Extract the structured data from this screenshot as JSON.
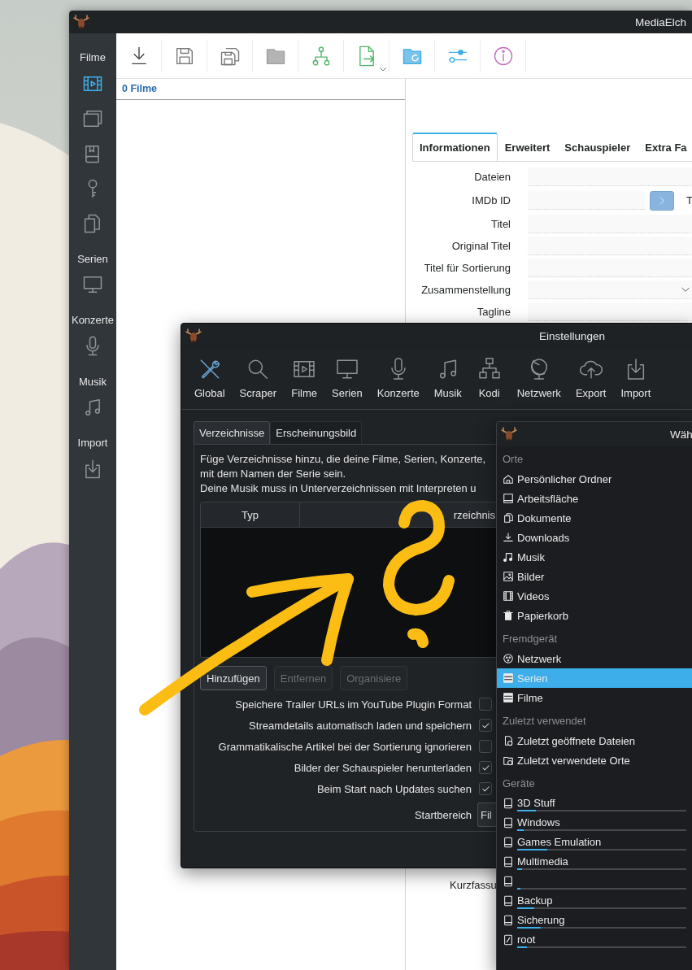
{
  "main_window": {
    "title": "MediaElch",
    "sidebar": [
      {
        "label": "Filme",
        "buttons": [
          {
            "selected": true
          },
          {
            "selected": false
          },
          {
            "selected": false
          },
          {
            "selected": false
          },
          {
            "selected": false
          }
        ]
      },
      {
        "label": "Serien",
        "buttons": [
          {
            "selected": false
          }
        ]
      },
      {
        "label": "Konzerte",
        "buttons": [
          {
            "selected": false
          }
        ]
      },
      {
        "label": "Musik",
        "buttons": [
          {
            "selected": false
          }
        ]
      },
      {
        "label": "Import",
        "buttons": [
          {
            "selected": false
          }
        ]
      }
    ],
    "list_header": "0 Filme",
    "tabs": [
      {
        "label": "Informationen",
        "selected": true
      },
      {
        "label": "Erweitert",
        "selected": false
      },
      {
        "label": "Schauspieler",
        "selected": false
      },
      {
        "label": "Extra Fa",
        "selected": false
      }
    ],
    "fields": [
      {
        "label": "Dateien",
        "kind": "text"
      },
      {
        "label": "IMDb ID",
        "kind": "id",
        "after": "T"
      },
      {
        "label": "Titel",
        "kind": "text"
      },
      {
        "label": "Original Titel",
        "kind": "text"
      },
      {
        "label": "Titel für Sortierung",
        "kind": "text"
      },
      {
        "label": "Zusammenstellung",
        "kind": "dropdown"
      },
      {
        "label": "Tagline",
        "kind": "text"
      }
    ],
    "lower_label": "Kurzfassu"
  },
  "settings": {
    "title": "Einstellungen",
    "categories": [
      {
        "label": "Global",
        "selected": true
      },
      {
        "label": "Scraper",
        "selected": false
      },
      {
        "label": "Filme",
        "selected": false
      },
      {
        "label": "Serien",
        "selected": false
      },
      {
        "label": "Konzerte",
        "selected": false
      },
      {
        "label": "Musik",
        "selected": false
      },
      {
        "label": "Kodi",
        "selected": false
      },
      {
        "label": "Netzwerk",
        "selected": false
      },
      {
        "label": "Export",
        "selected": false
      },
      {
        "label": "Import",
        "selected": false
      }
    ],
    "tabs": [
      {
        "label": "Verzeichnisse",
        "selected": true
      },
      {
        "label": "Erscheinungsbild",
        "selected": false
      }
    ],
    "description": [
      "Füge Verzeichnisse hinzu, die deine Filme, Serien, Konzerte,",
      "mit dem Namen der Serie sein.",
      "Deine Musik muss in Unterverzeichnissen mit Interpreten u"
    ],
    "table": {
      "columns": [
        "Typ",
        "rzeichnis"
      ]
    },
    "buttons": [
      {
        "label": "Hinzufügen",
        "disabled": false
      },
      {
        "label": "Entfernen",
        "disabled": true
      },
      {
        "label": "Organisiere",
        "disabled": true
      }
    ],
    "options": [
      {
        "label": "Speichere Trailer URLs im YouTube Plugin Format",
        "checked": false
      },
      {
        "label": "Streamdetails automatisch laden und speichern",
        "checked": true
      },
      {
        "label": "Grammatikalische Artikel bei der Sortierung ignorieren",
        "checked": false
      },
      {
        "label": "Bilder der Schauspieler herunterladen",
        "checked": true
      },
      {
        "label": "Beim Start nach Updates suchen",
        "checked": true
      }
    ],
    "start_area": {
      "label": "Startbereich",
      "value": "Fil"
    }
  },
  "file_dialog": {
    "title": "Wäh",
    "sections": [
      {
        "header": "Orte",
        "items": [
          {
            "label": "Persönlicher Ordner",
            "selected": false
          },
          {
            "label": "Arbeitsfläche",
            "selected": false
          },
          {
            "label": "Dokumente",
            "selected": false
          },
          {
            "label": "Downloads",
            "selected": false
          },
          {
            "label": "Musik",
            "selected": false
          },
          {
            "label": "Bilder",
            "selected": false
          },
          {
            "label": "Videos",
            "selected": false
          },
          {
            "label": "Papierkorb",
            "selected": false
          }
        ]
      },
      {
        "header": "Fremdgerät",
        "items": [
          {
            "label": "Netzwerk",
            "selected": false
          },
          {
            "label": "Serien",
            "selected": true
          },
          {
            "label": "Filme",
            "selected": false
          }
        ]
      },
      {
        "header": "Zuletzt verwendet",
        "items": [
          {
            "label": "Zuletzt geöffnete Dateien",
            "selected": false
          },
          {
            "label": "Zuletzt verwendete Orte",
            "selected": false
          }
        ]
      },
      {
        "header": "Geräte",
        "items": [
          {
            "label": "3D Stuff",
            "selected": false,
            "level": 0.11
          },
          {
            "label": "Windows",
            "selected": false,
            "level": 0.04
          },
          {
            "label": "Games Emulation",
            "selected": false,
            "level": 0.18
          },
          {
            "label": "Multimedia",
            "selected": false,
            "level": 0.03
          },
          {
            "selected": false,
            "level": 0.02
          },
          {
            "label": "Backup",
            "selected": false,
            "level": 0.1
          },
          {
            "label": "Sicherung",
            "selected": false,
            "level": 0.14
          },
          {
            "label": "root",
            "selected": false,
            "level": 0.06
          }
        ]
      }
    ]
  }
}
